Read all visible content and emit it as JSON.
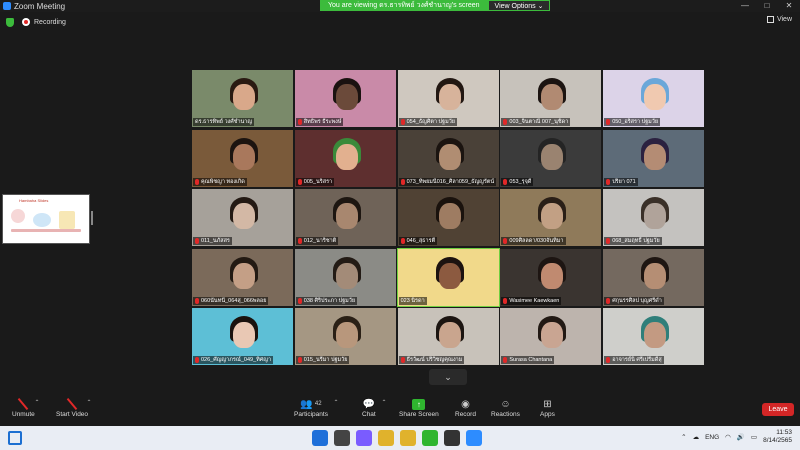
{
  "window": {
    "title": "Zoom Meeting",
    "controls": [
      "—",
      "□",
      "✕"
    ]
  },
  "share_banner": {
    "message": "You are viewing ดร.ธารทิพย์ วงศ์ชำนาญ's screen",
    "options_label": "View Options ⌄"
  },
  "status": {
    "recording_label": "Recording"
  },
  "view_button": {
    "label": "View"
  },
  "shared_screen": {
    "slide_title": "Hambaha Slides"
  },
  "gallery": {
    "participants": [
      {
        "name": "ดร.ธารทิพย์ วงศ์ชำนาญ",
        "muted": false,
        "bg": "#7a8a6a",
        "skin": "#d9a88a",
        "hair": "#2a1a12"
      },
      {
        "name": "สิทธิพร ธีระพงษ์",
        "muted": true,
        "bg": "#c98aa8",
        "skin": "#6b4a3a",
        "hair": "#1a1210"
      },
      {
        "name": "054_ธัญศิตา ปฐมวัย",
        "muted": true,
        "bg": "#cfc8bf",
        "skin": "#d7b39b",
        "hair": "#221712"
      },
      {
        "name": "003_จินตาณี 007_นุชิดา",
        "muted": true,
        "bg": "#c7c2bb",
        "skin": "#b18a72",
        "hair": "#1c1411"
      },
      {
        "name": "050_อริสรา ปฐมวัย",
        "muted": true,
        "bg": "#dcd3e8",
        "skin": "#f0c9b0",
        "hair": "#6aa7d9"
      },
      {
        "name": "คุณพิชญา ทองเกิด",
        "muted": true,
        "bg": "#7a5a3a",
        "skin": "#a9785c",
        "hair": "#1c1410"
      },
      {
        "name": "005_นริสรา",
        "muted": true,
        "bg": "#5e2f2f",
        "skin": "#e2b08f",
        "hair": "#3a8a3a"
      },
      {
        "name": "073_ทิพยมนี016_ศิลา059_ธัญญรัตน์",
        "muted": true,
        "bg": "#4a4138",
        "skin": "#b08d72",
        "hair": "#1b1410"
      },
      {
        "name": "053_รุจุดี",
        "muted": true,
        "bg": "#3b3b3b",
        "skin": "#9a8370",
        "hair": "#242424"
      },
      {
        "name": "ปริยา 071",
        "muted": true,
        "bg": "#5d6b78",
        "skin": "#b48c74",
        "hair": "#2b2140"
      },
      {
        "name": "011_นภัสสร",
        "muted": true,
        "bg": "#a6a19a",
        "skin": "#d3b8a5",
        "hair": "#241a14"
      },
      {
        "name": "012_นาริชาติ",
        "muted": true,
        "bg": "#6f6358",
        "skin": "#a8876f",
        "hair": "#1d1611"
      },
      {
        "name": "046_สุธารตี",
        "muted": true,
        "bg": "#504234",
        "skin": "#9e7c62",
        "hair": "#1a120d"
      },
      {
        "name": "009ศิลลดา/030จันทิมา",
        "muted": true,
        "bg": "#8f7a5a",
        "skin": "#c2a084",
        "hair": "#2a1f17"
      },
      {
        "name": "068_สมฤทธิ์ ปฐมวัย",
        "muted": true,
        "bg": "#c4c2bf",
        "skin": "#b0a39a",
        "hair": "#3a3028"
      },
      {
        "name": "060นันทนี_064สุ_066พลอย",
        "muted": true,
        "bg": "#7b6a5a",
        "skin": "#c49f86",
        "hair": "#231a13"
      },
      {
        "name": "038 ศิริประภา ปฐมวัย",
        "muted": true,
        "bg": "#8b8b86",
        "skin": "#a38b78",
        "hair": "#231b15"
      },
      {
        "name": "023 นิรดา",
        "muted": false,
        "bg": "#f1d98a",
        "skin": "#8c5a40",
        "hair": "#1c1210"
      },
      {
        "name": "Wasimee Kaewkaen",
        "muted": true,
        "bg": "#3a3430",
        "skin": "#c08a70",
        "hair": "#1d1512"
      },
      {
        "name": "ศกุนรรศิลป บุญศรีดำ",
        "muted": true,
        "bg": "#74695f",
        "skin": "#b58e74",
        "hair": "#1e1612"
      },
      {
        "name": "026_ศัญญาภรณ์_049_ทิศญา",
        "muted": true,
        "bg": "#5dbfd6",
        "skin": "#e9c8b4",
        "hair": "#1a120e"
      },
      {
        "name": "015_นรีมา ปฐมวัย",
        "muted": true,
        "bg": "#a59783",
        "skin": "#b8977c",
        "hair": "#2a2016"
      },
      {
        "name": "ธีรวัฒน์ ปริวิชญคุณงาม",
        "muted": true,
        "bg": "#c8c2ba",
        "skin": "#c9a58e",
        "hair": "#1c1511"
      },
      {
        "name": "Surasa Chantana",
        "muted": true,
        "bg": "#bdb4ad",
        "skin": "#c9a592",
        "hair": "#221914"
      },
      {
        "name": "อาจารย์นิ ศรีเปรีมดีสุ",
        "muted": true,
        "bg": "#cfcfcb",
        "skin": "#c39a82",
        "hair": "#2f7f7a"
      }
    ]
  },
  "toolbar": {
    "unmute_label": "Unmute",
    "start_video_label": "Start Video",
    "participants_label": "Participants",
    "participants_count": "42",
    "chat_label": "Chat",
    "share_screen_label": "Share Screen",
    "record_label": "Record",
    "reactions_label": "Reactions",
    "apps_label": "Apps",
    "leave_label": "Leave"
  },
  "taskbar": {
    "language": "ENG",
    "time": "11:53",
    "date": "8/14/2565",
    "app_colors": [
      "#1e6fd9",
      "#444",
      "#7a5cff",
      "#e0b22c",
      "#e0b22c",
      "#2fb52f",
      "#333",
      "#2d8cff"
    ]
  }
}
